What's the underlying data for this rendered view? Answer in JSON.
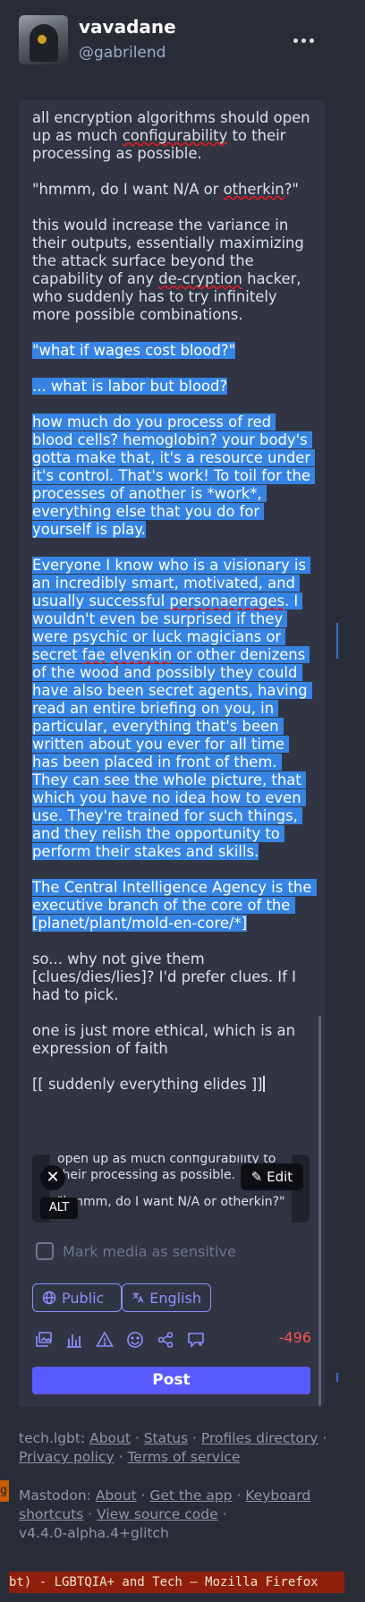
{
  "profile": {
    "display_name": "vavadane",
    "handle": "@gabrilend"
  },
  "compose": {
    "paragraphs": [
      {
        "text": "all encryption algorithms should open up as much configurability to their processing as possible.",
        "highlighted": false
      },
      {
        "text": "\"hmmm, do I want N/A or otherkin?\"",
        "highlighted": false
      },
      {
        "text": "this would increase the variance in their outputs, essentially maximizing the attack surface beyond the capability of any de-cryption hacker, who suddenly has to try infinitely more possible combinations.",
        "highlighted": false
      },
      {
        "text": "\"what if wages cost blood?\"",
        "highlighted": true
      },
      {
        "text": "... what is labor but blood?",
        "highlighted": true
      },
      {
        "text": "how much do you process of red blood cells? hemoglobin? your body's gotta make that, it's a resource under it's control. That's work! To toil for the processes of another is *work*, everything else that you do for yourself is play.",
        "highlighted": true
      },
      {
        "text": "Everyone I know who is a visionary is an incredibly smart, motivated, and usually successful personaerrages. I wouldn't even be surprised if they were psychic or luck magicians or secret fae elvenkin or other denizens of the wood and possibly they could have also been secret agents, having read an entire briefing on you, in particular, everything that's been written about you ever for all time has been placed in front of them. They can see the whole picture, that which you have no idea how to even use. They're trained for such things, and they relish the opportunity to perform their stakes and skills.",
        "highlighted": true
      },
      {
        "text": "The Central Intelligence Agency is the executive branch of the core of the [planet/plant/mold-en-core/*]",
        "highlighted": true
      },
      {
        "text": "so... why not give them [clues/dies/lies]? I'd prefer clues. If I had to pick.",
        "highlighted": false
      },
      {
        "text": "one is just more ethical, which is an expression of faith",
        "highlighted": false
      },
      {
        "text": "[[ suddenly everything elides ]]",
        "highlighted": false
      }
    ],
    "media": {
      "preview_line1": "open up as much configurability to",
      "preview_line2": "their processing as possible.",
      "preview_line3": "\"hmmm, do I want N/A or otherkin?\"",
      "close_glyph": "✕",
      "edit_label": "Edit",
      "alt_label": "ALT"
    },
    "sensitive_label": "Mark media as sensitive",
    "visibility_label": "Public",
    "language_label": "English",
    "char_counter": "-496",
    "post_label": "Post",
    "icons": [
      "image-icon",
      "poll-icon",
      "warning-icon",
      "emoji-icon",
      "share-icon",
      "quote-icon"
    ]
  },
  "footer": {
    "server": "tech.lgbt",
    "server_links": [
      "About",
      "Status",
      "Profiles directory",
      "Privacy policy",
      "Terms of service"
    ],
    "mastodon": "Mastodon",
    "mastodon_links": [
      "About",
      "Get the app",
      "Keyboard shortcuts",
      "View source code"
    ],
    "version": "v4.4.0-alpha.4+glitch"
  },
  "window": {
    "title": "bt) - LGBTQIA+ and Tech — Mozilla Firefox",
    "side_tab": "g"
  },
  "colors": {
    "accent": "#8c8dff",
    "post_button": "#595aff",
    "selection": "#3584e4",
    "counter_negative": "#ff5050"
  }
}
